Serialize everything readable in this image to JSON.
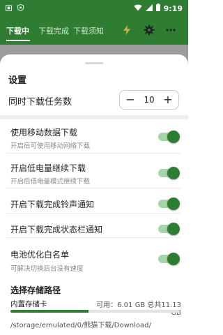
{
  "status_bar": {
    "time": "9:19",
    "left_icons": [
      "notification-square-icon",
      "shield-icon"
    ],
    "right_icons": [
      "wifi-icon",
      "signal-icon",
      "battery-icon"
    ]
  },
  "app_bar": {
    "tabs": [
      {
        "label": "下载中",
        "active": true
      },
      {
        "label": "下载完成",
        "active": false
      },
      {
        "label": "下载须知",
        "active": false
      }
    ],
    "actions": [
      "lightning-icon",
      "gear-icon",
      "more-vertical-icon"
    ],
    "accent_color": "#2e7d32"
  },
  "settings": {
    "title": "设置",
    "concurrency": {
      "label": "同时下载任务数",
      "value": "10",
      "minus_symbol": "−",
      "plus_symbol": "+"
    },
    "toggles": [
      {
        "title": "使用移动数据下载",
        "subtitle": "开启后可使用移动网络下载",
        "on": true
      },
      {
        "title": "开启低电量继续下载",
        "subtitle": "开启后低电量模式继续下载",
        "on": true
      },
      {
        "title": "开启下载完成铃声通知",
        "subtitle": "",
        "on": true
      },
      {
        "title": "开启下载完成状态栏通知",
        "subtitle": "",
        "on": true
      },
      {
        "title": "电池优化白名单",
        "subtitle": "可解决切换后台没有速度",
        "on": true
      }
    ],
    "storage": {
      "section_title": "选择存储路径",
      "name": "内置存储卡",
      "available_text": "可用：6.01 GB 总共11.13 GB",
      "used_fraction": 0.46,
      "path": "/storage/emulated/0/熊猫下载/Download/"
    }
  }
}
